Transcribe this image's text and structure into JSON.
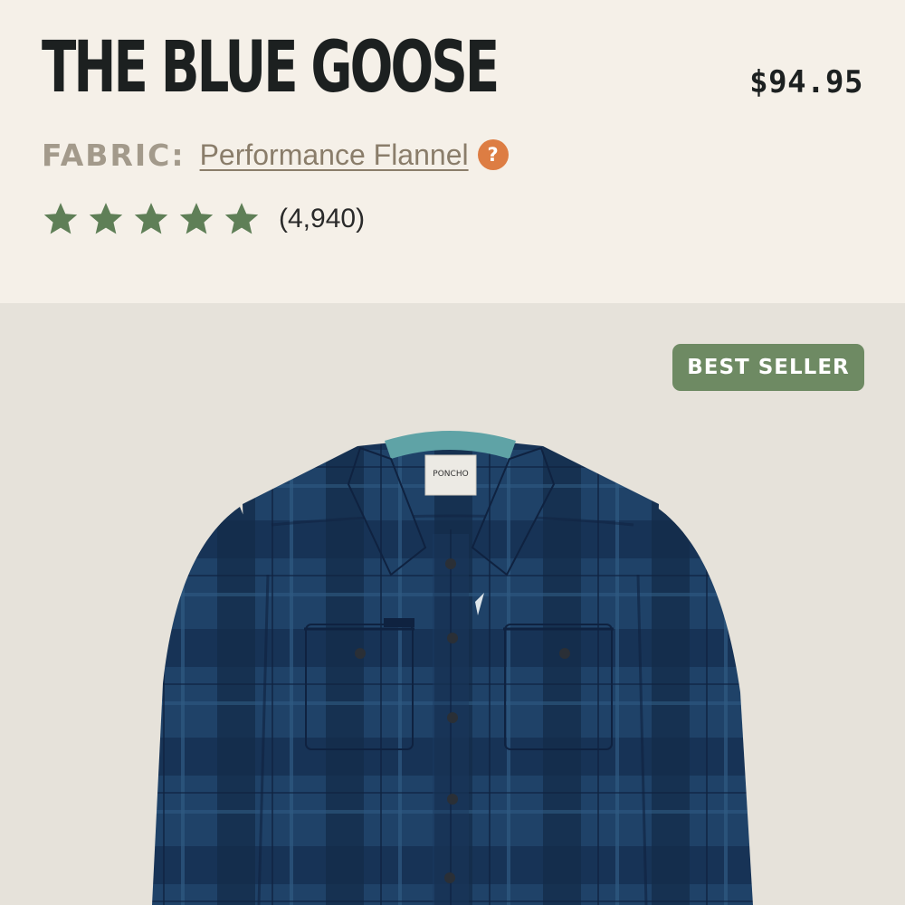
{
  "product": {
    "title": "THE BLUE GOOSE",
    "price": "$94.95",
    "fabric_label": "FABRIC:",
    "fabric_value": "Performance Flannel",
    "help_icon": "?",
    "rating": {
      "stars": 5,
      "count_text": "(4,940)"
    },
    "badge": "BEST SELLER",
    "image": {
      "brand_tag": "PONCHO"
    }
  },
  "icons": {
    "star": "star-icon",
    "help": "question-mark-icon"
  },
  "colors": {
    "header_bg": "#f5f0e8",
    "image_bg": "#e6e2da",
    "title": "#1c2020",
    "fabric_label": "#a39a8b",
    "fabric_link": "#8a7d6a",
    "help_icon": "#dd7d43",
    "star": "#5f7f57",
    "badge": "#6e8a63",
    "shirt": "#1d3e63"
  }
}
